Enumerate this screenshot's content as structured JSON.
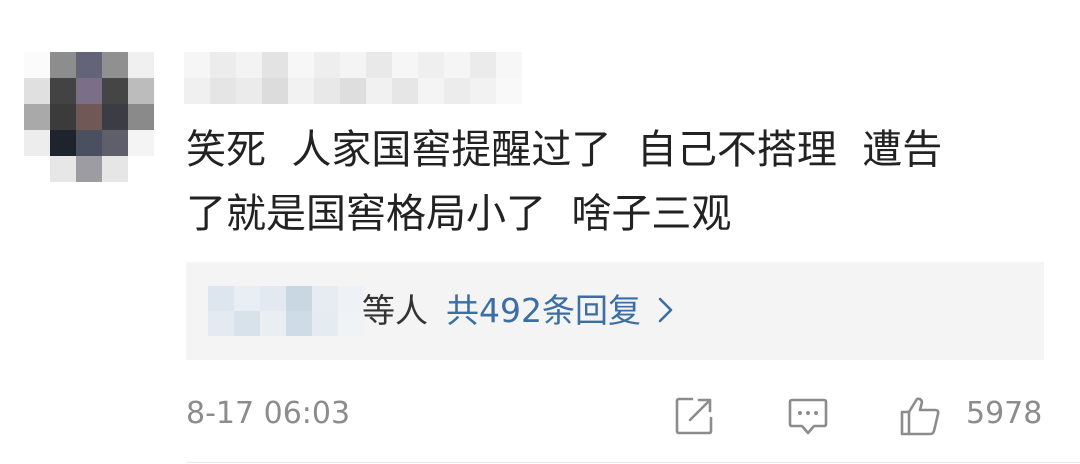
{
  "comment": {
    "author": "",
    "text": "笑死  人家国窖提醒过了  自己不搭理  遭告\n了就是国窖格局小了  啥子三观"
  },
  "replies": {
    "names_suffix": "等人",
    "count_label": "共492条回复",
    "arrow": "›"
  },
  "footer": {
    "timestamp": "8-17 06:03",
    "like_count": "5978"
  },
  "icons": [
    "share-icon",
    "comment-icon",
    "like-icon",
    "chevron-right-icon"
  ],
  "colors": {
    "text": "#222222",
    "muted": "#8c8c8c",
    "link": "#3a6ea5",
    "reply_bg": "#f4f4f4"
  }
}
